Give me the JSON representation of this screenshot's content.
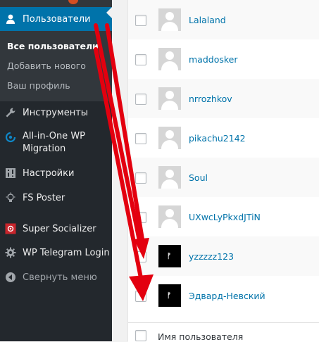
{
  "sidebar": {
    "active_item": "Пользователи",
    "submenu": [
      "Все пользователи",
      "Добавить нового",
      "Ваш профиль"
    ],
    "items": [
      {
        "label": "Инструменты",
        "icon": "wrench-icon"
      },
      {
        "label": "All-in-One WP\nMigration",
        "icon": "migration-icon"
      },
      {
        "label": "Настройки",
        "icon": "settings-icon"
      },
      {
        "label": "FS Poster",
        "icon": "lightbulb-icon"
      },
      {
        "label": "Super Socializer",
        "icon": "socializer-icon"
      },
      {
        "label": "WP Telegram Login",
        "icon": "gear-icon"
      }
    ],
    "collapse_label": "Свернуть меню"
  },
  "users": [
    {
      "name": "Lalaland",
      "avatar": "default"
    },
    {
      "name": "maddosker",
      "avatar": "default"
    },
    {
      "name": "nrrozhkov",
      "avatar": "default"
    },
    {
      "name": "pikachu2142",
      "avatar": "default"
    },
    {
      "name": "Soul",
      "avatar": "default"
    },
    {
      "name": "UXwcLyPkxdJTiN",
      "avatar": "default"
    },
    {
      "name": "yzzzzz123",
      "avatar": "dark"
    },
    {
      "name": "Эдвард-Невский",
      "avatar": "dark"
    }
  ],
  "footer_column": "Имя пользователя",
  "colors": {
    "sidebar_bg": "#23282d",
    "active_bg": "#0073aa",
    "link": "#0073aa",
    "annotation_arrow": "#e3000f"
  }
}
